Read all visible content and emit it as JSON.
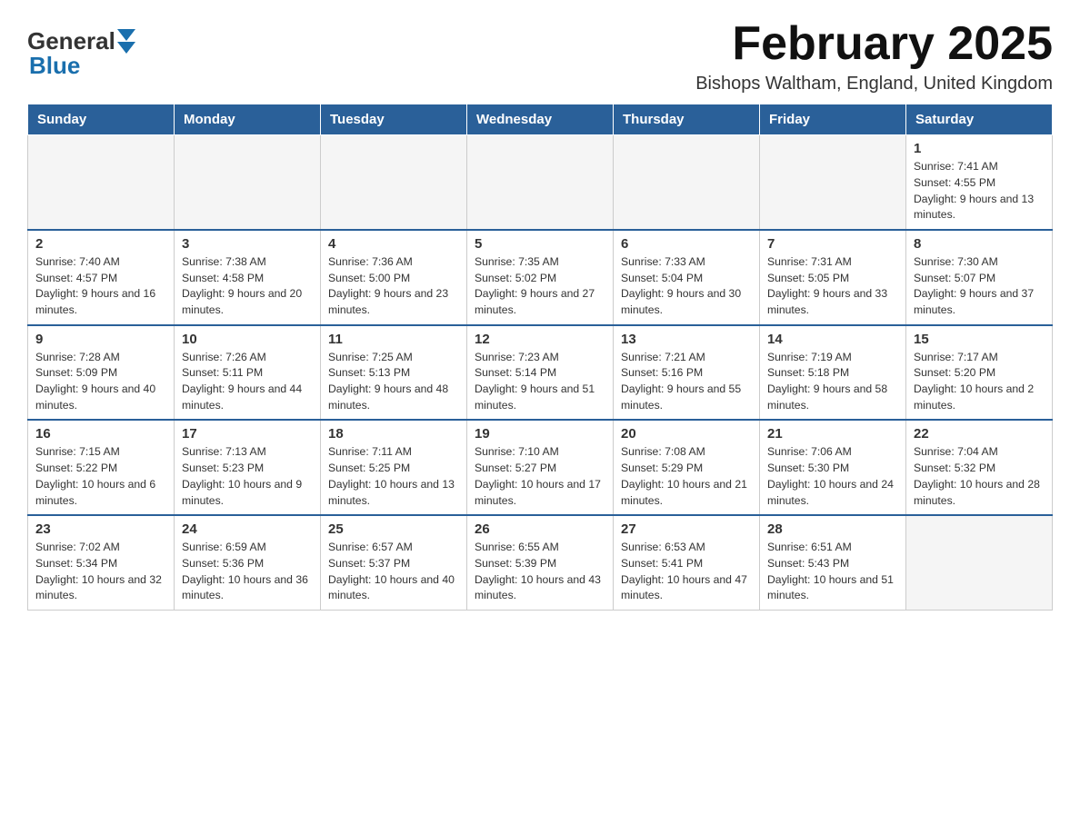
{
  "header": {
    "logo_general": "General",
    "logo_blue": "Blue",
    "title": "February 2025",
    "location": "Bishops Waltham, England, United Kingdom"
  },
  "weekdays": [
    "Sunday",
    "Monday",
    "Tuesday",
    "Wednesday",
    "Thursday",
    "Friday",
    "Saturday"
  ],
  "weeks": [
    [
      {
        "day": "",
        "info": ""
      },
      {
        "day": "",
        "info": ""
      },
      {
        "day": "",
        "info": ""
      },
      {
        "day": "",
        "info": ""
      },
      {
        "day": "",
        "info": ""
      },
      {
        "day": "",
        "info": ""
      },
      {
        "day": "1",
        "info": "Sunrise: 7:41 AM\nSunset: 4:55 PM\nDaylight: 9 hours and 13 minutes."
      }
    ],
    [
      {
        "day": "2",
        "info": "Sunrise: 7:40 AM\nSunset: 4:57 PM\nDaylight: 9 hours and 16 minutes."
      },
      {
        "day": "3",
        "info": "Sunrise: 7:38 AM\nSunset: 4:58 PM\nDaylight: 9 hours and 20 minutes."
      },
      {
        "day": "4",
        "info": "Sunrise: 7:36 AM\nSunset: 5:00 PM\nDaylight: 9 hours and 23 minutes."
      },
      {
        "day": "5",
        "info": "Sunrise: 7:35 AM\nSunset: 5:02 PM\nDaylight: 9 hours and 27 minutes."
      },
      {
        "day": "6",
        "info": "Sunrise: 7:33 AM\nSunset: 5:04 PM\nDaylight: 9 hours and 30 minutes."
      },
      {
        "day": "7",
        "info": "Sunrise: 7:31 AM\nSunset: 5:05 PM\nDaylight: 9 hours and 33 minutes."
      },
      {
        "day": "8",
        "info": "Sunrise: 7:30 AM\nSunset: 5:07 PM\nDaylight: 9 hours and 37 minutes."
      }
    ],
    [
      {
        "day": "9",
        "info": "Sunrise: 7:28 AM\nSunset: 5:09 PM\nDaylight: 9 hours and 40 minutes."
      },
      {
        "day": "10",
        "info": "Sunrise: 7:26 AM\nSunset: 5:11 PM\nDaylight: 9 hours and 44 minutes."
      },
      {
        "day": "11",
        "info": "Sunrise: 7:25 AM\nSunset: 5:13 PM\nDaylight: 9 hours and 48 minutes."
      },
      {
        "day": "12",
        "info": "Sunrise: 7:23 AM\nSunset: 5:14 PM\nDaylight: 9 hours and 51 minutes."
      },
      {
        "day": "13",
        "info": "Sunrise: 7:21 AM\nSunset: 5:16 PM\nDaylight: 9 hours and 55 minutes."
      },
      {
        "day": "14",
        "info": "Sunrise: 7:19 AM\nSunset: 5:18 PM\nDaylight: 9 hours and 58 minutes."
      },
      {
        "day": "15",
        "info": "Sunrise: 7:17 AM\nSunset: 5:20 PM\nDaylight: 10 hours and 2 minutes."
      }
    ],
    [
      {
        "day": "16",
        "info": "Sunrise: 7:15 AM\nSunset: 5:22 PM\nDaylight: 10 hours and 6 minutes."
      },
      {
        "day": "17",
        "info": "Sunrise: 7:13 AM\nSunset: 5:23 PM\nDaylight: 10 hours and 9 minutes."
      },
      {
        "day": "18",
        "info": "Sunrise: 7:11 AM\nSunset: 5:25 PM\nDaylight: 10 hours and 13 minutes."
      },
      {
        "day": "19",
        "info": "Sunrise: 7:10 AM\nSunset: 5:27 PM\nDaylight: 10 hours and 17 minutes."
      },
      {
        "day": "20",
        "info": "Sunrise: 7:08 AM\nSunset: 5:29 PM\nDaylight: 10 hours and 21 minutes."
      },
      {
        "day": "21",
        "info": "Sunrise: 7:06 AM\nSunset: 5:30 PM\nDaylight: 10 hours and 24 minutes."
      },
      {
        "day": "22",
        "info": "Sunrise: 7:04 AM\nSunset: 5:32 PM\nDaylight: 10 hours and 28 minutes."
      }
    ],
    [
      {
        "day": "23",
        "info": "Sunrise: 7:02 AM\nSunset: 5:34 PM\nDaylight: 10 hours and 32 minutes."
      },
      {
        "day": "24",
        "info": "Sunrise: 6:59 AM\nSunset: 5:36 PM\nDaylight: 10 hours and 36 minutes."
      },
      {
        "day": "25",
        "info": "Sunrise: 6:57 AM\nSunset: 5:37 PM\nDaylight: 10 hours and 40 minutes."
      },
      {
        "day": "26",
        "info": "Sunrise: 6:55 AM\nSunset: 5:39 PM\nDaylight: 10 hours and 43 minutes."
      },
      {
        "day": "27",
        "info": "Sunrise: 6:53 AM\nSunset: 5:41 PM\nDaylight: 10 hours and 47 minutes."
      },
      {
        "day": "28",
        "info": "Sunrise: 6:51 AM\nSunset: 5:43 PM\nDaylight: 10 hours and 51 minutes."
      },
      {
        "day": "",
        "info": ""
      }
    ]
  ]
}
